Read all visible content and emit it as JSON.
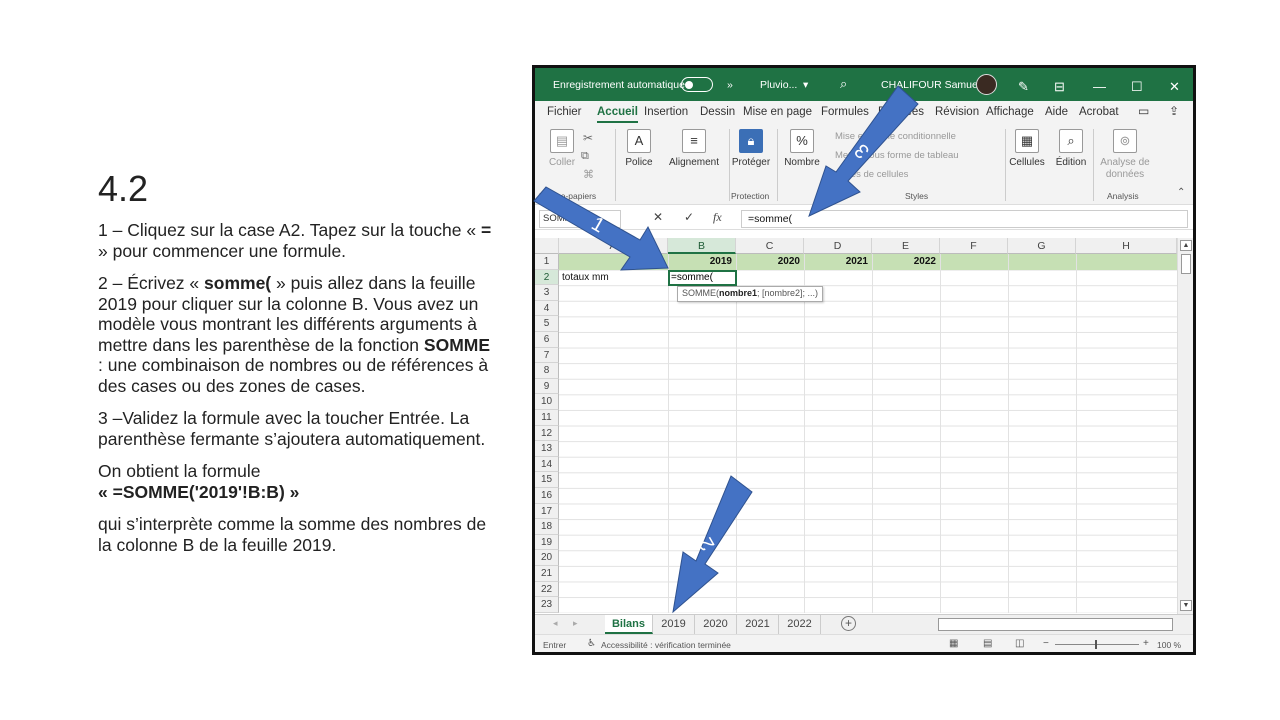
{
  "slide": {
    "title": "4.2",
    "step1_a": "1 – Cliquez sur la case A2. Tapez sur la touche « ",
    "step1_key": "=",
    "step1_b": " » pour commencer une formule.",
    "step2_a": "2 – Écrivez « ",
    "step2_key": "somme(",
    "step2_b": " » puis allez dans la feuille 2019 pour cliquer sur la colonne B. Vous avez un modèle vous montrant les différents arguments à mettre dans les parenthèse de la fonction ",
    "step2_fn": "SOMME",
    "step2_c": " : une combinaison de nombres ou de références à des cases ou des zones de cases.",
    "step3": "3 –Validez la formule avec la toucher Entrée. La parenthèse fermante s’ajoutera automatiquement.",
    "result_intro": "On obtient la formule",
    "result_formula": "« =SOMME('2019'!B:B) »",
    "interpretation": "qui s’interprète comme la somme des nombres de la colonne B de la feuille 2019."
  },
  "excel": {
    "titlebar": {
      "autosave": "Enregistrement automatique",
      "more": "»",
      "filename": "Pluvio...",
      "search_icon": "search-icon",
      "user": "CHALIFOUR Samuel",
      "minimize": "—",
      "restore": "☐",
      "close": "✕"
    },
    "menu": [
      "Fichier",
      "Accueil",
      "Insertion",
      "Dessin",
      "Mise en page",
      "Formules",
      "Données",
      "Révision",
      "Affichage",
      "Aide",
      "Acrobat"
    ],
    "ribbon": {
      "coller": "Coller",
      "presse_papiers": "Presse-papiers",
      "police": "Police",
      "alignement": "Alignement",
      "proteger": "Protéger",
      "protection": "Protection",
      "nombre": "Nombre",
      "mise_en_forme": "Mise en forme conditionnelle",
      "tableau": "Mettre sous forme de tableau",
      "styles_cellules": "Styles de cellules",
      "styles": "Styles",
      "cellules": "Cellules",
      "edition": "Édition",
      "analyse": "Analyse de données",
      "analysis": "Analysis"
    },
    "formula_bar": {
      "namebox": "SOMME",
      "cancel": "✕",
      "enter": "✓",
      "fx": "fx",
      "content": "=somme("
    },
    "columns": [
      "A",
      "B",
      "C",
      "D",
      "E",
      "F",
      "G",
      "H"
    ],
    "rows": [
      "1",
      "2",
      "3",
      "4",
      "5",
      "6",
      "7",
      "8",
      "9",
      "10",
      "11",
      "12",
      "13",
      "14",
      "15",
      "16",
      "17",
      "18",
      "19",
      "20",
      "21",
      "22",
      "23"
    ],
    "cells": {
      "b1": "2019",
      "c1": "2020",
      "d1": "2021",
      "e1": "2022",
      "a2": "totaux mm",
      "b2": "=somme("
    },
    "tooltip": {
      "fn": "SOMME(",
      "arg1": "nombre1",
      "rest": "; [nombre2]; ...)"
    },
    "tabs": [
      "Bilans",
      "2019",
      "2020",
      "2021",
      "2022"
    ],
    "add_sheet": "+",
    "status": {
      "mode": "Entrer",
      "accessibility": "Accessibilité : vérification terminée",
      "zoom": "100 %"
    }
  },
  "annotations": {
    "arrow1": "1",
    "arrow2": "2",
    "arrow3": "3",
    "arrow_color": "#4472c4"
  }
}
